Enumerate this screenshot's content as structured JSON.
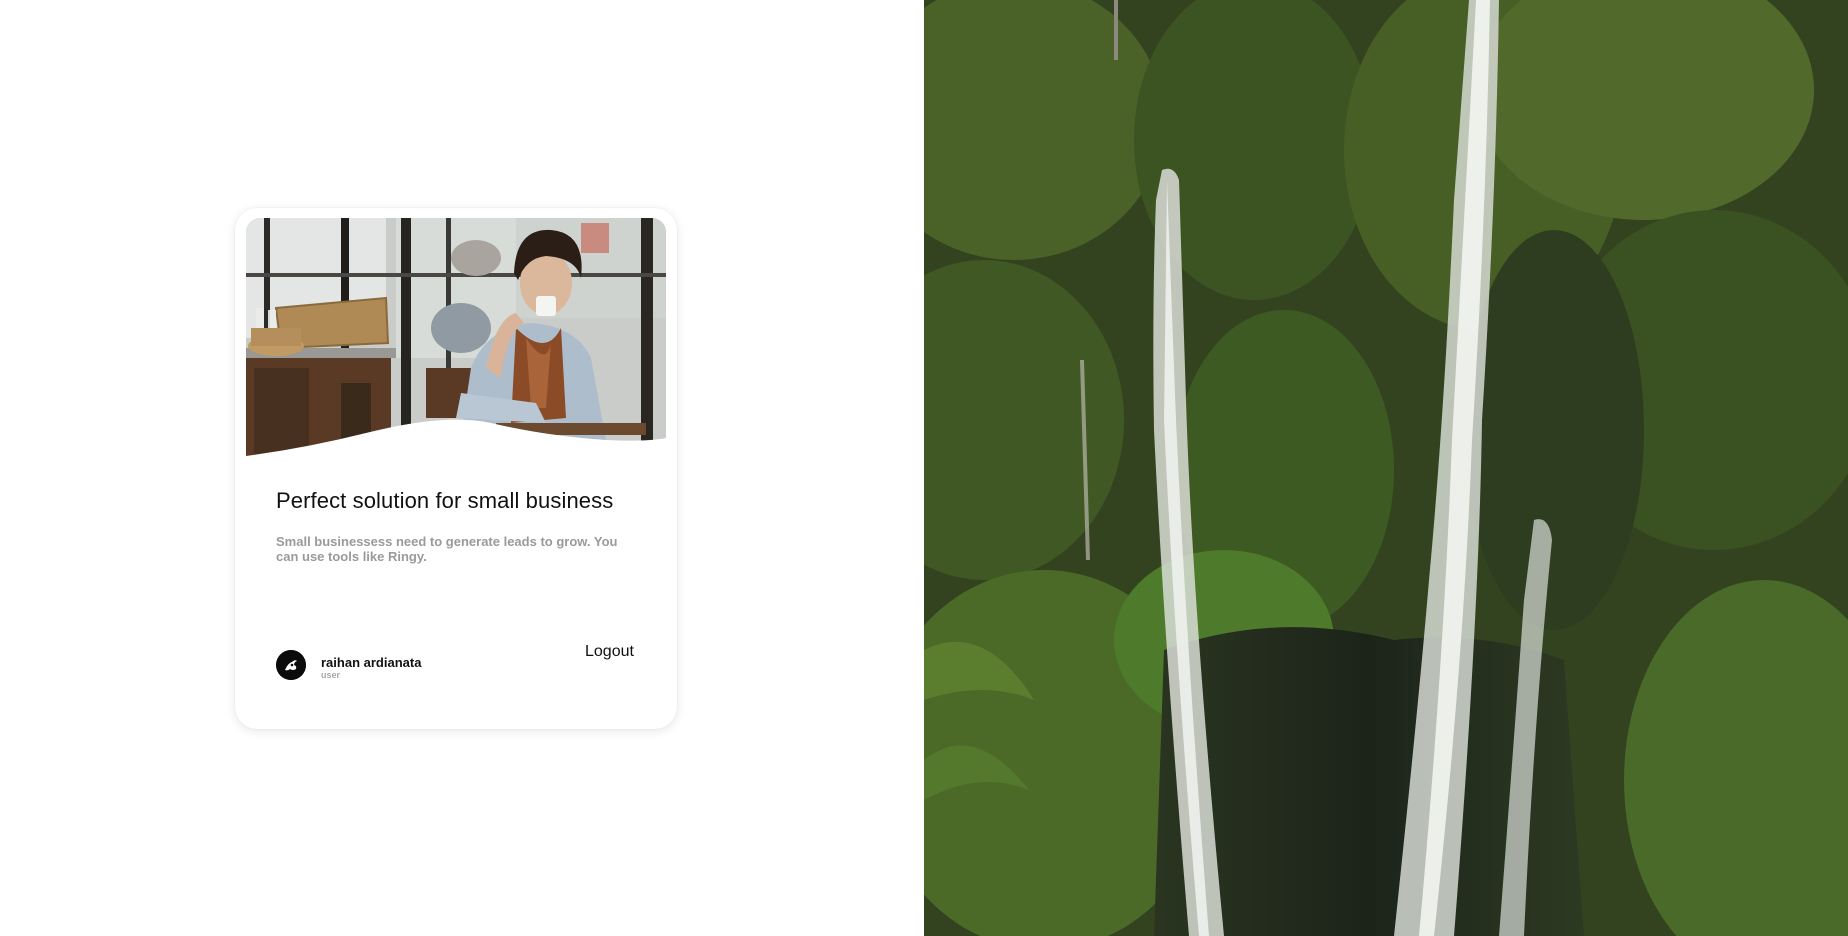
{
  "card": {
    "title": "Perfect solution for small business",
    "description": "Small businessess need to generate leads to grow. You can use tools like Ringy.",
    "image": "man-drinking-coffee-cafe-photo",
    "author": {
      "name": "raihan ardianata",
      "role": "user",
      "avatar": "avatar-logo-icon"
    },
    "logout_label": "Logout"
  },
  "background": {
    "image": "tropical-waterfall-photo"
  },
  "colors": {
    "card_bg": "#ffffff",
    "title": "#111111",
    "description": "#9a9a9a",
    "foliage": "#2f3d22"
  }
}
